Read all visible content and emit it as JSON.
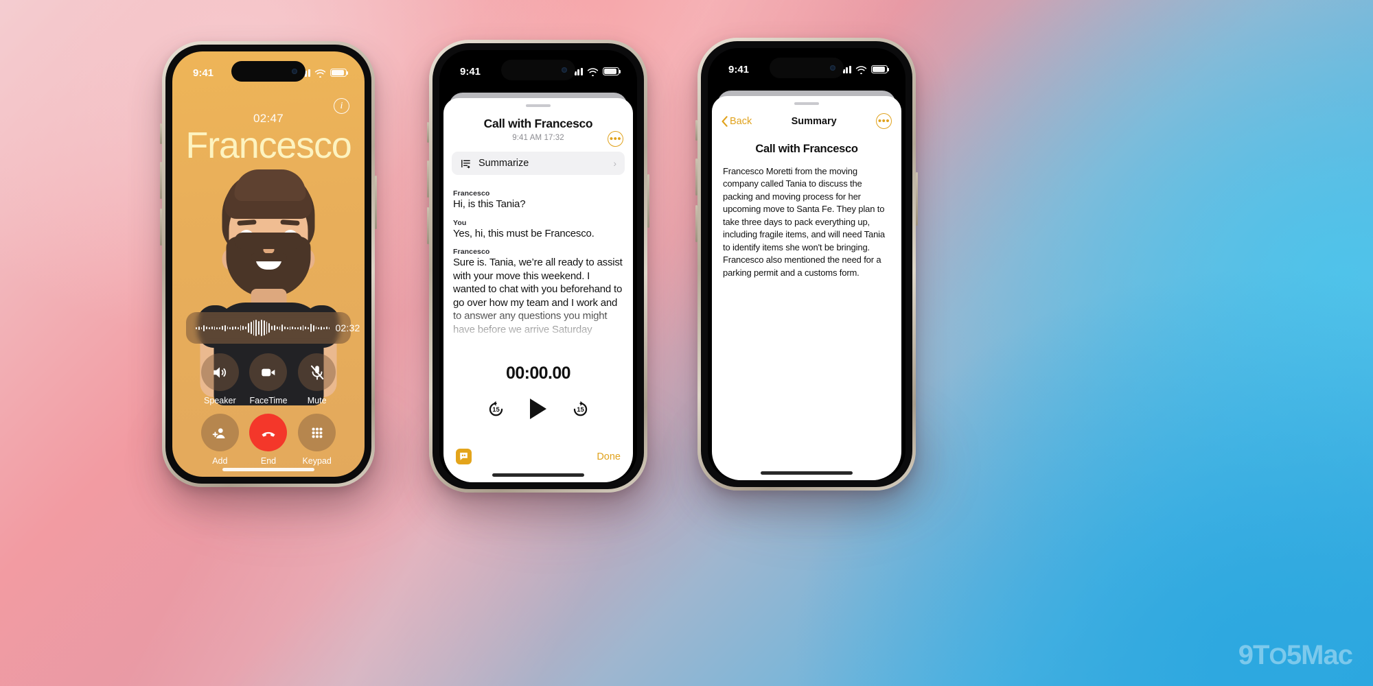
{
  "phone1": {
    "status": {
      "time": "9:41",
      "signal_icon": "cellular-bars-icon",
      "wifi_icon": "wifi-icon",
      "battery_icon": "battery-icon"
    },
    "call": {
      "duration": "02:47",
      "contact_name": "Francesco",
      "info_icon": "info-icon"
    },
    "recorder": {
      "elapsed": "02:32",
      "stop_icon": "record-stop-icon",
      "waveform_icon": "audio-waveform-icon"
    },
    "actions": [
      {
        "label": "Speaker",
        "icon": "speaker-icon",
        "style": "normal"
      },
      {
        "label": "FaceTime",
        "icon": "video-icon",
        "style": "normal"
      },
      {
        "label": "Mute",
        "icon": "mic-off-icon",
        "style": "normal"
      },
      {
        "label": "Add",
        "icon": "add-person-icon",
        "style": "normal"
      },
      {
        "label": "End",
        "icon": "end-call-icon",
        "style": "end"
      },
      {
        "label": "Keypad",
        "icon": "keypad-icon",
        "style": "normal"
      }
    ]
  },
  "phone2": {
    "status": {
      "time": "9:41"
    },
    "title": "Call with Francesco",
    "subtitle": "9:41 AM  17:32",
    "more_icon": "more-dots-icon",
    "summarize": {
      "label": "Summarize",
      "icon": "summarize-icon",
      "chevron": "chevron-right-icon"
    },
    "transcript": [
      {
        "speaker": "Francesco",
        "text": "Hi, is this Tania?"
      },
      {
        "speaker": "You",
        "text": "Yes, hi, this must be Francesco."
      },
      {
        "speaker": "Francesco",
        "text": "Sure is. Tania, we’re all ready to assist with your move this weekend. I wanted to chat with you beforehand to go over how my team and I work and to answer any questions you might have before we arrive Saturday"
      }
    ],
    "player": {
      "time": "00:00.00",
      "back_label": "15",
      "forward_label": "15",
      "back_icon": "skip-back-15-icon",
      "play_icon": "play-icon",
      "forward_icon": "skip-forward-15-icon"
    },
    "footer": {
      "quote_icon": "transcript-quote-icon",
      "done_label": "Done"
    }
  },
  "phone3": {
    "status": {
      "time": "9:41"
    },
    "nav": {
      "back_label": "Back",
      "back_icon": "chevron-left-icon",
      "title": "Summary",
      "more_icon": "more-dots-icon"
    },
    "heading": "Call with Francesco",
    "body": "Francesco Moretti from the moving company called Tania to discuss the packing and moving process for her upcoming move to Santa Fe. They plan to take three days to pack everything up, including fragile items, and will need Tania to identify items she won't be bringing. Francesco also mentioned the need for a parking permit and a customs form."
  },
  "watermark": "9T O 5 Mac",
  "colors": {
    "accent": "#e0a21d",
    "call_bg": "#e9af5a",
    "end_red": "#f4372a",
    "record_red": "#f1412e",
    "name_cream": "#fdf3c0"
  }
}
